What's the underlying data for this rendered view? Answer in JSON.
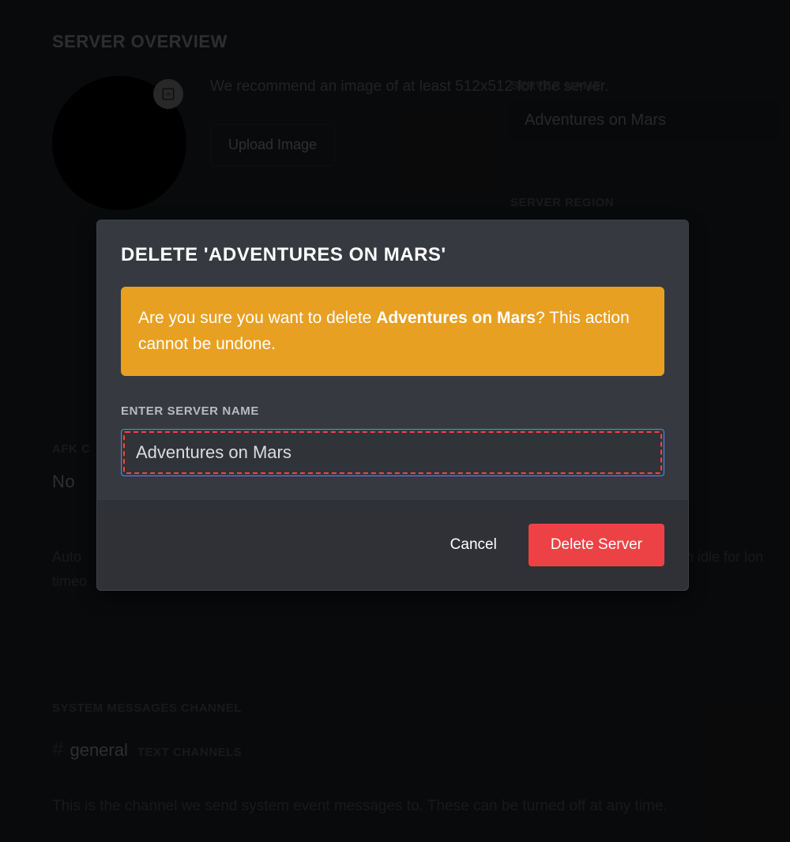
{
  "page": {
    "title": "SERVER OVERVIEW",
    "recommend_text": "We recommend an image of at least 512x512 for the server.",
    "upload_button": "Upload Image",
    "server_name_label": "SERVER NAME",
    "server_name_value": "Adventures on Mars",
    "server_region_label": "SERVER REGION",
    "afk_label": "AFK C",
    "afk_value": "No",
    "afk_desc_line1": "Auto",
    "afk_desc_line2": "timeo",
    "afk_desc_line1_right": "en idle for lon",
    "sys_label": "SYSTEM MESSAGES CHANNEL",
    "sys_channel": "general",
    "sys_text_channels": "TEXT CHANNELS",
    "sys_desc": "This is the channel we send system event messages to. These can be turned off at any time."
  },
  "modal": {
    "title": "DELETE 'ADVENTURES ON MARS'",
    "warn_prefix": "Are you sure you want to delete ",
    "warn_bold": "Adventures on Mars",
    "warn_suffix": "? This action cannot be undone.",
    "input_label": "ENTER SERVER NAME",
    "input_value": "Adventures on Mars",
    "cancel": "Cancel",
    "delete": "Delete Server"
  }
}
